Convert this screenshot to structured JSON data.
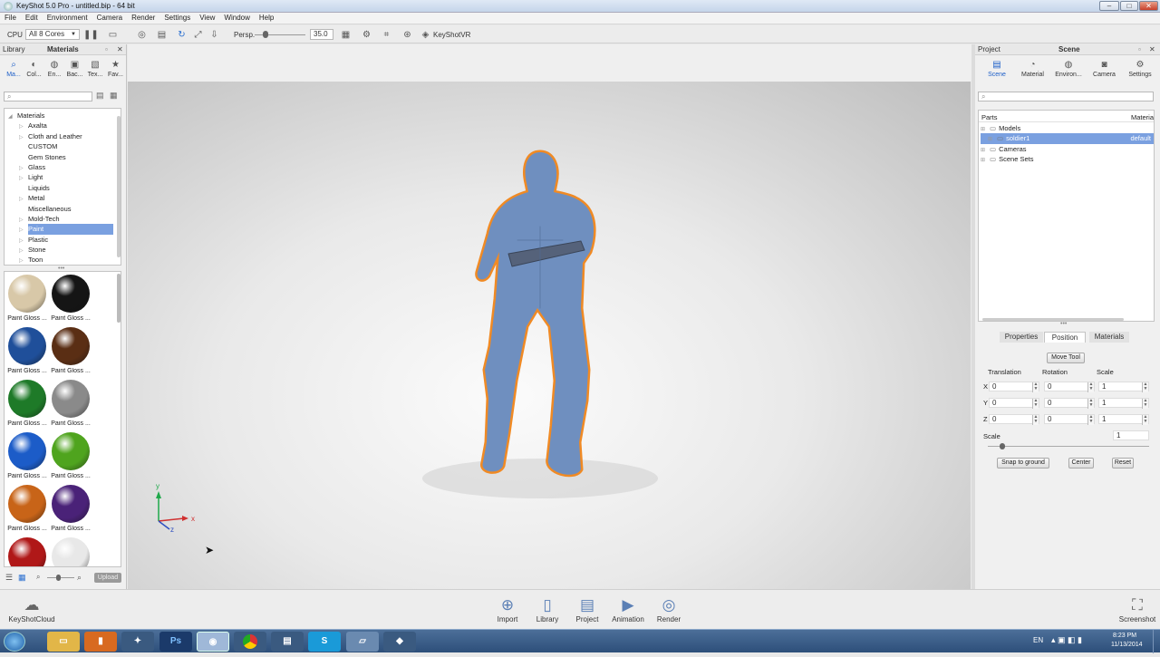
{
  "title": "KeyShot 5.0 Pro - untitled.bip - 64 bit",
  "menu": [
    "File",
    "Edit",
    "Environment",
    "Camera",
    "Render",
    "Settings",
    "View",
    "Window",
    "Help"
  ],
  "toolbar": {
    "cpu_label": "CPU",
    "cores": "All 8 Cores",
    "persp": "Persp.",
    "fov": "35.0",
    "vr": "KeyShotVR"
  },
  "library": {
    "header": "Library",
    "title": "Materials",
    "tabs": [
      "Ma...",
      "Col...",
      "En...",
      "Bac...",
      "Tex...",
      "Fav..."
    ],
    "tree": [
      {
        "label": "Materials",
        "level": 0,
        "exp": true
      },
      {
        "label": "Axalta",
        "level": 1,
        "arrow": true
      },
      {
        "label": "Cloth and Leather",
        "level": 1,
        "arrow": true
      },
      {
        "label": "CUSTOM",
        "level": 1,
        "arrow": false
      },
      {
        "label": "Gem Stones",
        "level": 1,
        "arrow": false
      },
      {
        "label": "Glass",
        "level": 1,
        "arrow": true
      },
      {
        "label": "Light",
        "level": 1,
        "arrow": true
      },
      {
        "label": "Liquids",
        "level": 1,
        "arrow": false
      },
      {
        "label": "Metal",
        "level": 1,
        "arrow": true
      },
      {
        "label": "Miscellaneous",
        "level": 1,
        "arrow": false
      },
      {
        "label": "Mold-Tech",
        "level": 1,
        "arrow": true
      },
      {
        "label": "Paint",
        "level": 1,
        "arrow": true,
        "selected": true
      },
      {
        "label": "Plastic",
        "level": 1,
        "arrow": true
      },
      {
        "label": "Stone",
        "level": 1,
        "arrow": true
      },
      {
        "label": "Toon",
        "level": 1,
        "arrow": true
      }
    ],
    "swatches": [
      {
        "label": "Paint Gloss ...",
        "color": "#d8c8a8"
      },
      {
        "label": "Paint Gloss ...",
        "color": "#151515"
      },
      {
        "label": "Paint Gloss ...",
        "color": "#1f4f9a"
      },
      {
        "label": "Paint Gloss ...",
        "color": "#5a2e14"
      },
      {
        "label": "Paint Gloss ...",
        "color": "#1e7a28"
      },
      {
        "label": "Paint Gloss ...",
        "color": "#8a8a8a"
      },
      {
        "label": "Paint Gloss ...",
        "color": "#1c5cc8"
      },
      {
        "label": "Paint Gloss ...",
        "color": "#4fa41e"
      },
      {
        "label": "Paint Gloss ...",
        "color": "#c86418"
      },
      {
        "label": "Paint Gloss ...",
        "color": "#4a2278"
      },
      {
        "label": "",
        "color": "#b01818"
      },
      {
        "label": "",
        "color": "#e8e8e8"
      }
    ],
    "upload": "Upload"
  },
  "project": {
    "header": "Project",
    "title": "Scene",
    "tabs": [
      "Scene",
      "Material",
      "Environ...",
      "Camera",
      "Settings"
    ],
    "parts_label": "Parts",
    "materials_col": "Materia",
    "tree": [
      {
        "label": "Models",
        "level": 0
      },
      {
        "label": "soldier1",
        "level": 1,
        "selected": true,
        "mat": "default"
      },
      {
        "label": "Cameras",
        "level": 0
      },
      {
        "label": "Scene Sets",
        "level": 0
      }
    ],
    "subtabs": [
      "Properties",
      "Position",
      "Materials"
    ],
    "move_tool": "Move Tool",
    "cols": [
      "Translation",
      "Rotation",
      "Scale"
    ],
    "rows": [
      {
        "axis": "X",
        "t": "0",
        "r": "0",
        "s": "1"
      },
      {
        "axis": "Y",
        "t": "0",
        "r": "0",
        "s": "1"
      },
      {
        "axis": "Z",
        "t": "0",
        "r": "0",
        "s": "1"
      }
    ],
    "scale_label": "Scale",
    "scale_value": "1",
    "buttons": [
      "Snap to ground",
      "Center",
      "Reset"
    ]
  },
  "viewport": {
    "axis_x": "x",
    "axis_y": "y",
    "axis_z": "z",
    "model_color": "#6f8fbf",
    "outline": "#f08a24"
  },
  "bottom": {
    "cloud": "KeyShotCloud",
    "items": [
      "Import",
      "Library",
      "Project",
      "Animation",
      "Render"
    ],
    "screenshot": "Screenshot"
  },
  "taskbar": {
    "lang": "EN",
    "time": "8:23 PM",
    "date": "11/13/2014",
    "apps": [
      "Ps"
    ]
  }
}
